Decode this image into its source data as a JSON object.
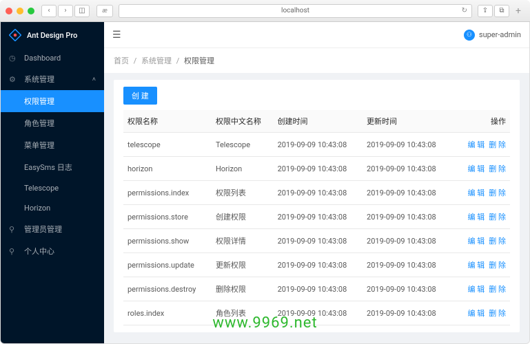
{
  "browser": {
    "url": "localhost",
    "ext": "æ"
  },
  "app": {
    "title": "Ant Design Pro",
    "user": "super-admin"
  },
  "sidebar": {
    "dashboard": "Dashboard",
    "system": "系统管理",
    "permission": "权限管理",
    "role": "角色管理",
    "menu": "菜单管理",
    "easysms": "EasySms 日志",
    "telescope": "Telescope",
    "horizon": "Horizon",
    "admin": "管理员管理",
    "personal": "个人中心"
  },
  "breadcrumb": {
    "home": "首页",
    "system": "系统管理",
    "current": "权限管理"
  },
  "content": {
    "create_btn": "创 建"
  },
  "table": {
    "headers": {
      "name": "权限名称",
      "cn_name": "权限中文名称",
      "created": "创建时间",
      "updated": "更新时间",
      "action": "操作"
    },
    "actions": {
      "edit": "编 辑",
      "delete": "删 除"
    },
    "rows": [
      {
        "name": "telescope",
        "cn": "Telescope",
        "created": "2019-09-09 10:43:08",
        "updated": "2019-09-09 10:43:08"
      },
      {
        "name": "horizon",
        "cn": "Horizon",
        "created": "2019-09-09 10:43:08",
        "updated": "2019-09-09 10:43:08"
      },
      {
        "name": "permissions.index",
        "cn": "权限列表",
        "created": "2019-09-09 10:43:08",
        "updated": "2019-09-09 10:43:08"
      },
      {
        "name": "permissions.store",
        "cn": "创建权限",
        "created": "2019-09-09 10:43:08",
        "updated": "2019-09-09 10:43:08"
      },
      {
        "name": "permissions.show",
        "cn": "权限详情",
        "created": "2019-09-09 10:43:08",
        "updated": "2019-09-09 10:43:08"
      },
      {
        "name": "permissions.update",
        "cn": "更新权限",
        "created": "2019-09-09 10:43:08",
        "updated": "2019-09-09 10:43:08"
      },
      {
        "name": "permissions.destroy",
        "cn": "删除权限",
        "created": "2019-09-09 10:43:08",
        "updated": "2019-09-09 10:43:08"
      },
      {
        "name": "roles.index",
        "cn": "角色列表",
        "created": "2019-09-09 10:43:08",
        "updated": "2019-09-09 10:43:08"
      }
    ]
  },
  "watermark": "www.9969.net"
}
